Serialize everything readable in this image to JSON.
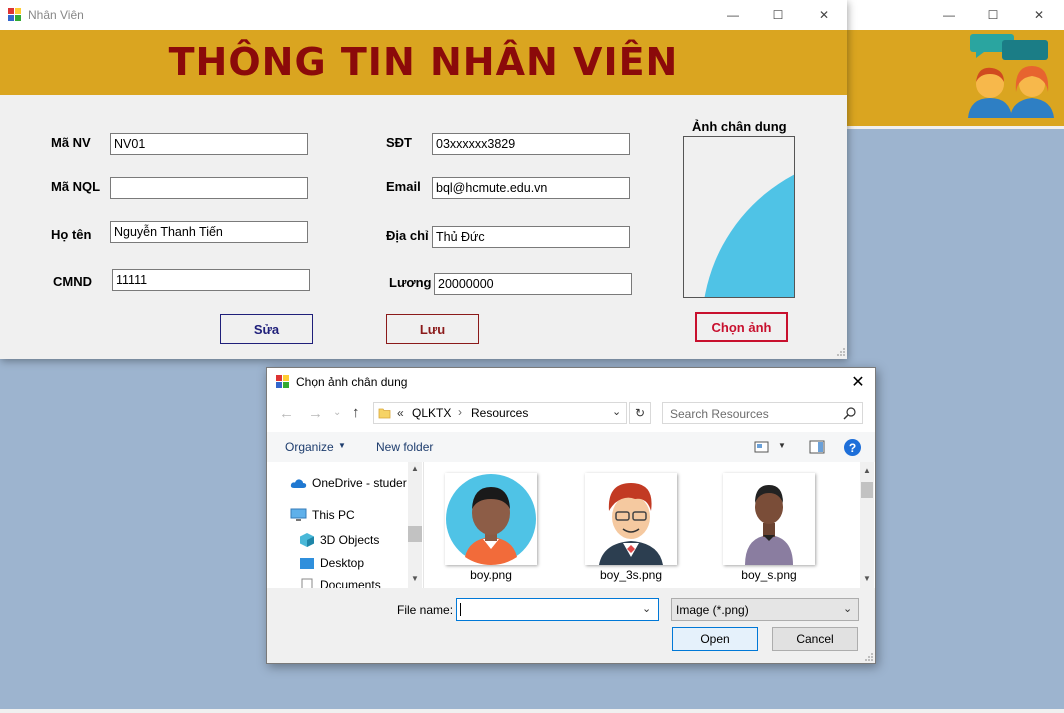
{
  "bg_window": {
    "controls": {
      "minimize": "—",
      "maximize": "☐",
      "close": "✕"
    }
  },
  "employee_window": {
    "title": "Nhân Viên",
    "header": "THÔNG TIN NHÂN VIÊN",
    "fields": {
      "ma_nv": {
        "label": "Mã NV",
        "value": "NV01"
      },
      "ma_nql": {
        "label": "Mã NQL",
        "value": ""
      },
      "ho_ten": {
        "label": "Họ tên",
        "value": "Nguyễn Thanh Tiến"
      },
      "cmnd": {
        "label": "CMND",
        "value": "11111"
      },
      "sdt": {
        "label": "SĐT",
        "value": "03xxxxxx3829"
      },
      "email": {
        "label": "Email",
        "value": "bql@hcmute.edu.vn"
      },
      "dia_chi": {
        "label": "Địa chỉ",
        "value": "Thủ Đức"
      },
      "luong": {
        "label": "Lương",
        "value": "20000000"
      }
    },
    "portrait_label": "Ảnh chân dung",
    "buttons": {
      "edit": "Sửa",
      "save": "Lưu",
      "choose_image": "Chọn ảnh"
    },
    "colors": {
      "header_bg": "#daa520",
      "header_text": "#8b0a0a"
    }
  },
  "file_dialog": {
    "title": "Chọn ảnh chân dung",
    "breadcrumb": {
      "overflow": "«",
      "parts": [
        "QLKTX",
        "Resources"
      ]
    },
    "search_placeholder": "Search Resources",
    "toolbar": {
      "organize": "Organize",
      "new_folder": "New folder"
    },
    "nav_tree": [
      {
        "label": "OneDrive - studer",
        "icon": "cloud-icon"
      },
      {
        "label": "This PC",
        "icon": "computer-icon"
      },
      {
        "label": "3D Objects",
        "icon": "cube-icon"
      },
      {
        "label": "Desktop",
        "icon": "desktop-icon"
      },
      {
        "label": "Documents",
        "icon": "documents-icon"
      }
    ],
    "files": [
      {
        "name": "boy.png"
      },
      {
        "name": "boy_3s.png"
      },
      {
        "name": "boy_s.png"
      }
    ],
    "filename_label": "File name:",
    "filename_value": "",
    "filter": "Image (*.png)",
    "buttons": {
      "open": "Open",
      "cancel": "Cancel"
    }
  }
}
